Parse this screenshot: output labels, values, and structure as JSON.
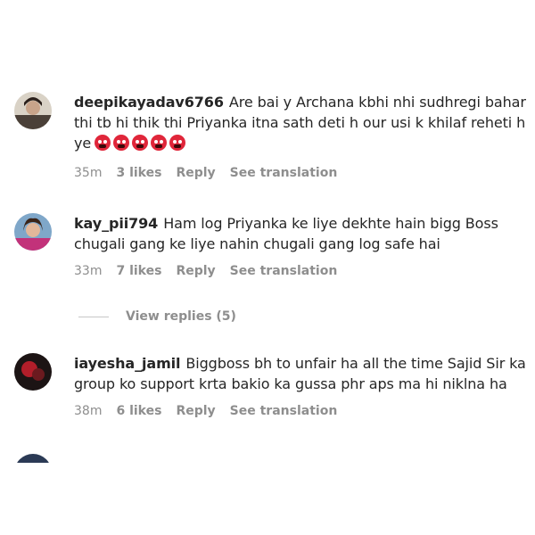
{
  "comments": [
    {
      "username": "deepikayadav6766",
      "text": "Are bai y Archana kbhi nhi sudhregi bahar thi tb hi thik thi Priyanka itna sath deti h our usi k khilaf reheti h ye",
      "emoji_icons": [
        "angry-face-icon",
        "angry-face-icon",
        "angry-face-icon",
        "angry-face-icon",
        "angry-face-icon"
      ],
      "emoji_color": "#e0263a",
      "time": "35m",
      "likes": "3 likes",
      "reply": "Reply",
      "translate": "See translation"
    },
    {
      "username": "kay_pii794",
      "text": "Ham log Priyanka ke liye dekhte hain bigg Boss chugali gang ke liye nahin chugali gang log safe hai",
      "time": "33m",
      "likes": "7 likes",
      "reply": "Reply",
      "translate": "See translation"
    },
    {
      "username": "iayesha_jamil",
      "text": "Biggboss bh to unfair ha all the time Sajid Sir ka group ko support krta bakio ka gussa phr aps ma hi niklna ha",
      "time": "38m",
      "likes": "6 likes",
      "reply": "Reply",
      "translate": "See translation"
    }
  ],
  "view_replies": "View replies (5)",
  "colors": {
    "text": "#262626",
    "muted": "#8e8e8e",
    "divider": "#c7c7c7",
    "background": "#ffffff"
  }
}
